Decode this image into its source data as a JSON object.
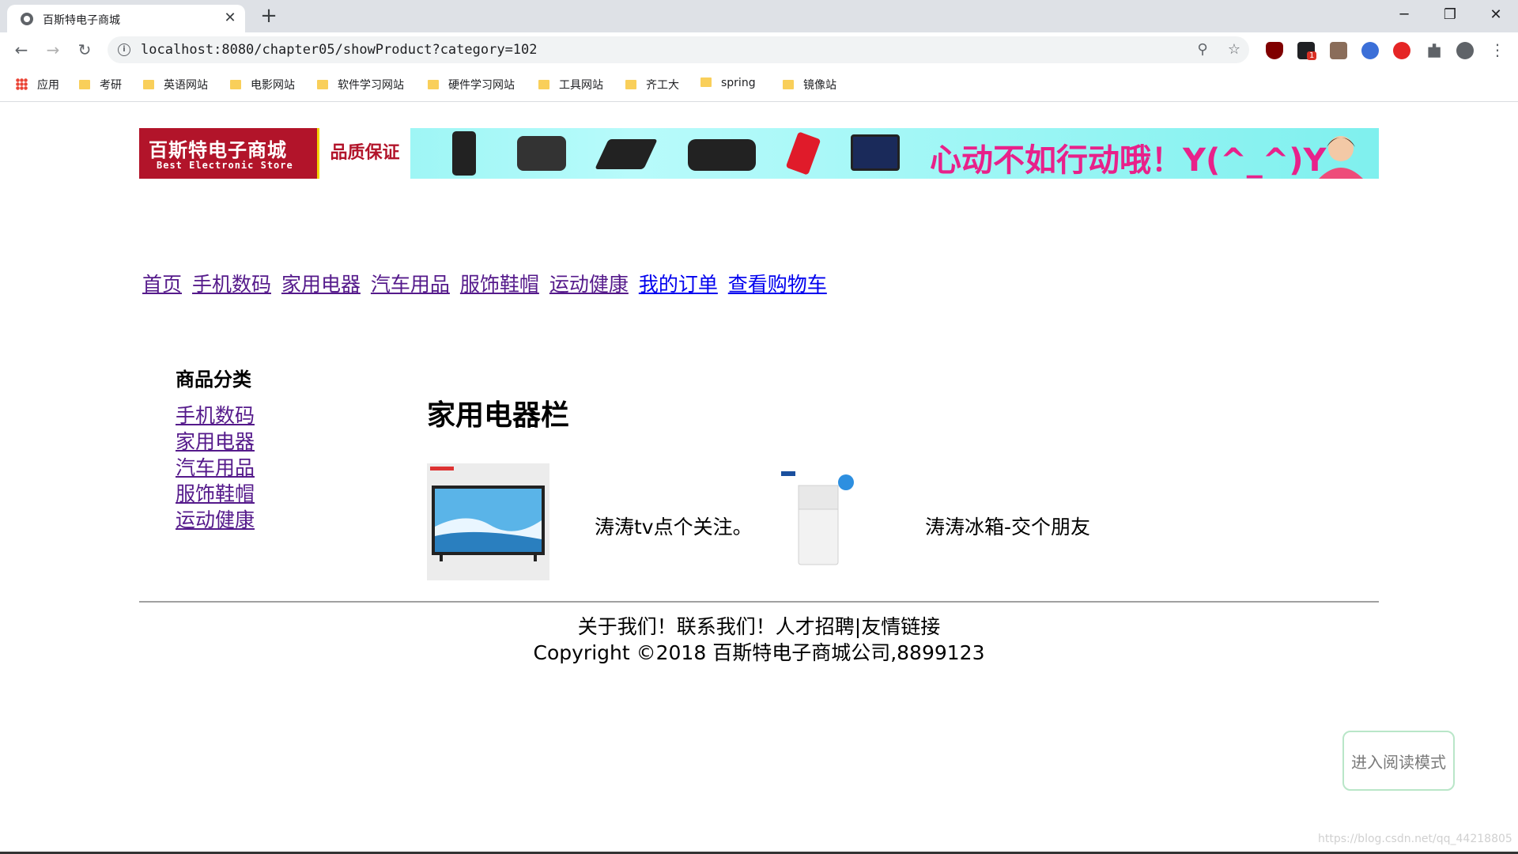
{
  "browser": {
    "tab_title": "百斯特电子商城",
    "url": "localhost:8080/chapter05/showProduct?category=102",
    "window_controls": {
      "minimize": "─",
      "restore": "❐",
      "close": "✕"
    },
    "tab_close": "✕",
    "new_tab": "+",
    "icons": {
      "back": "←",
      "forward": "→",
      "reload": "↻",
      "zoom": "⚲",
      "star": "☆",
      "menu": "⋮",
      "info": "i"
    },
    "bookmarks": [
      {
        "label": "应用",
        "icon": "apps-grid-icon"
      },
      {
        "label": "考研",
        "icon": "folder-icon"
      },
      {
        "label": "英语网站",
        "icon": "folder-icon"
      },
      {
        "label": "电影网站",
        "icon": "folder-icon"
      },
      {
        "label": "软件学习网站",
        "icon": "folder-icon"
      },
      {
        "label": "硬件学习网站",
        "icon": "folder-icon"
      },
      {
        "label": "工具网站",
        "icon": "folder-icon"
      },
      {
        "label": "齐工大",
        "icon": "folder-icon"
      },
      {
        "label": "spring",
        "icon": "folder-icon"
      },
      {
        "label": "镜像站",
        "icon": "folder-icon"
      }
    ],
    "extension_badge": "1"
  },
  "banner": {
    "brand_cn": "百斯特电子商城",
    "brand_en": "Best Electronic Store",
    "quality": "品质保证",
    "slogan": "心动不如行动哦！Y(^_^)Y"
  },
  "topnav": {
    "items": [
      "首页",
      "手机数码",
      "家用电器",
      "汽车用品",
      "服饰鞋帽",
      "运动健康",
      "我的订单",
      "查看购物车"
    ]
  },
  "sidebar": {
    "title": "商品分类",
    "items": [
      "手机数码",
      "家用电器",
      "汽车用品",
      "服饰鞋帽",
      "运动健康"
    ]
  },
  "main": {
    "section_title": "家用电器栏",
    "products": [
      {
        "name": "涛涛tv点个关注。",
        "image": "tv-product-image"
      },
      {
        "name": "涛涛冰箱-交个朋友",
        "image": "fridge-product-image"
      }
    ]
  },
  "footer": {
    "links_line": "关于我们！联系我们！人才招聘|友情链接",
    "copyright": "Copyright ©2018 百斯特电子商城公司,8899123"
  },
  "reader_mode": "进入阅读模式",
  "watermark": "https://blog.csdn.net/qq_44218805",
  "colors": {
    "visited_link": "#551a8b",
    "link": "#0000ee",
    "brand_red": "#b2142a",
    "slogan_pink": "#e8218a"
  }
}
